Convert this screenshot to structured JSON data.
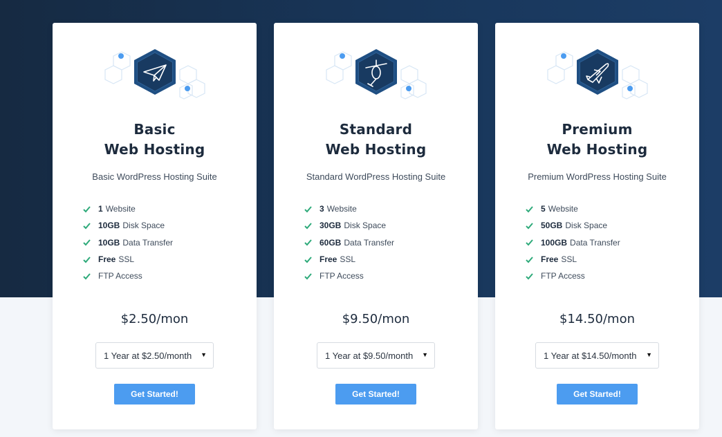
{
  "colors": {
    "accent": "#4c9cf0",
    "hero_dark": "#162a42",
    "hero_light": "#1c3d66",
    "check": "#2eaa7a",
    "hex_fill": "#183a61"
  },
  "plans": [
    {
      "icon": "paper-plane-icon",
      "title_line1": "Basic",
      "title_line2": "Web Hosting",
      "subtitle": "Basic WordPress Hosting Suite",
      "features": [
        {
          "bold": "1",
          "text": "Website"
        },
        {
          "bold": "10GB",
          "text": "Disk Space"
        },
        {
          "bold": "10GB",
          "text": "Data Transfer"
        },
        {
          "bold": "Free",
          "text": "SSL"
        },
        {
          "bold": "",
          "text": "FTP Access"
        }
      ],
      "price": "$2.50/mon",
      "select_value": "1 Year at $2.50/month",
      "button_label": "Get Started!"
    },
    {
      "icon": "helicopter-icon",
      "title_line1": "Standard",
      "title_line2": "Web Hosting",
      "subtitle": "Standard WordPress Hosting Suite",
      "features": [
        {
          "bold": "3",
          "text": "Website"
        },
        {
          "bold": "30GB",
          "text": "Disk Space"
        },
        {
          "bold": "60GB",
          "text": "Data Transfer"
        },
        {
          "bold": "Free",
          "text": "SSL"
        },
        {
          "bold": "",
          "text": "FTP Access"
        }
      ],
      "price": "$9.50/mon",
      "select_value": "1 Year at $9.50/month",
      "button_label": "Get Started!"
    },
    {
      "icon": "airplane-icon",
      "title_line1": "Premium",
      "title_line2": "Web Hosting",
      "subtitle": "Premium WordPress Hosting Suite",
      "features": [
        {
          "bold": "5",
          "text": "Website"
        },
        {
          "bold": "50GB",
          "text": "Disk Space"
        },
        {
          "bold": "100GB",
          "text": "Data Transfer"
        },
        {
          "bold": "Free",
          "text": "SSL"
        },
        {
          "bold": "",
          "text": "FTP Access"
        }
      ],
      "price": "$14.50/mon",
      "select_value": "1 Year at $14.50/month",
      "button_label": "Get Started!"
    }
  ]
}
